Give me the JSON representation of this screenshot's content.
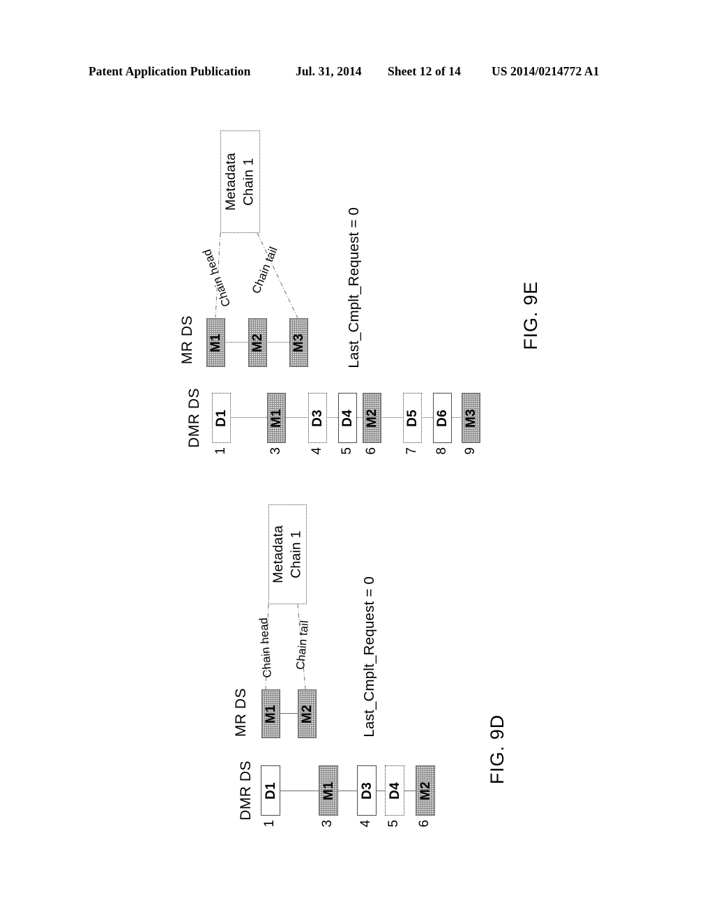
{
  "header": {
    "publication": "Patent Application Publication",
    "date": "Jul. 31, 2014",
    "sheet": "Sheet 12 of 14",
    "number": "US 2014/0214772 A1"
  },
  "figures": [
    {
      "id": "fig-9e",
      "label": "FIG. 9E",
      "row_labels": {
        "mr": "MR DS",
        "dmr": "DMR DS"
      },
      "metadata_box": {
        "line1": "Metadata",
        "line2": "Chain 1"
      },
      "chain_head_label": "Chain head",
      "chain_tail_label": "Chain tail",
      "status": "Last_Cmplt_Request = 0",
      "connector_style": "dotted",
      "mr_ds": [
        {
          "label": "M1",
          "style": "shaded"
        },
        {
          "label": "M2",
          "style": "shaded"
        },
        {
          "label": "M3",
          "style": "shaded"
        }
      ],
      "dmr_ds": [
        {
          "index": "1",
          "label": "D1",
          "style": "dotted"
        },
        {
          "index": "3",
          "label": "M1",
          "style": "shaded"
        },
        {
          "index": "4",
          "label": "D3",
          "style": "dotted"
        },
        {
          "index": "5",
          "label": "D4",
          "style": "solid"
        },
        {
          "index": "6",
          "label": "M2",
          "style": "shaded"
        },
        {
          "index": "7",
          "label": "D5",
          "style": "dotted"
        },
        {
          "index": "8",
          "label": "D6",
          "style": "solid"
        },
        {
          "index": "9",
          "label": "M3",
          "style": "shaded"
        }
      ]
    },
    {
      "id": "fig-9d",
      "label": "FIG. 9D",
      "row_labels": {
        "mr": "MR DS",
        "dmr": "DMR DS"
      },
      "metadata_box": {
        "line1": "Metadata",
        "line2": "Chain 1"
      },
      "chain_head_label": "Chain head",
      "chain_tail_label": "Chain tail",
      "status": "Last_Cmplt_Request = 0",
      "connector_style": "solid",
      "mr_ds": [
        {
          "label": "M1",
          "style": "shaded"
        },
        {
          "label": "M2",
          "style": "shaded"
        }
      ],
      "dmr_ds": [
        {
          "index": "1",
          "label": "D1",
          "style": "solid"
        },
        {
          "index": "3",
          "label": "M1",
          "style": "shaded"
        },
        {
          "index": "4",
          "label": "D3",
          "style": "solid"
        },
        {
          "index": "5",
          "label": "D4",
          "style": "dotted"
        },
        {
          "index": "6",
          "label": "M2",
          "style": "shaded"
        }
      ]
    }
  ]
}
